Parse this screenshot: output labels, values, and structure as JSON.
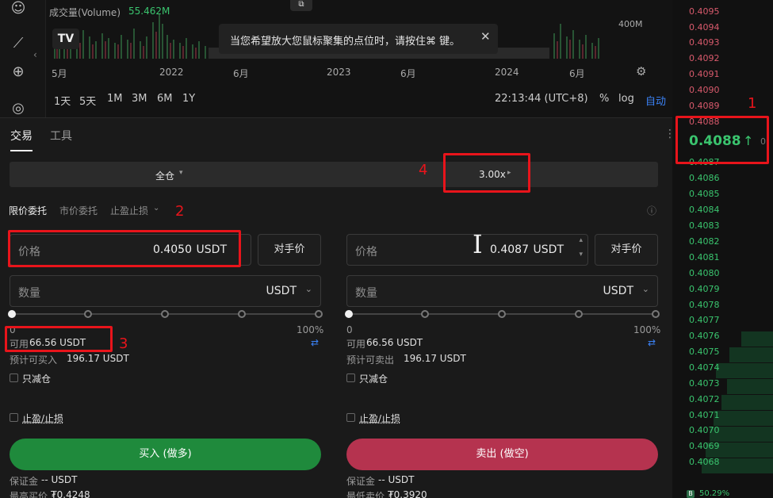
{
  "chart": {
    "volume_label": "成交量(Volume)",
    "volume_value": "55.462M",
    "axis_volume": "400M",
    "x_labels": [
      "5月",
      "2022",
      "6月",
      "2023",
      "6月",
      "2024",
      "6月"
    ],
    "tooltip": "当您希望放大您鼠标聚集的点位时，请按住⌘ 键。",
    "timeframes": [
      "1天",
      "5天",
      "1M",
      "3M",
      "6M",
      "1Y"
    ],
    "time": "22:13:44 (UTC+8)",
    "pct": "%",
    "log": "log",
    "auto": "自动"
  },
  "tabs": {
    "trade": "交易",
    "tools": "工具"
  },
  "margin": {
    "mode": "全仓",
    "leverage": "3.00x"
  },
  "order_types": {
    "limit": "限价委托",
    "market": "市价委托",
    "tpsl": "止盈止损"
  },
  "buy": {
    "price_label": "价格",
    "price_value": "0.4050",
    "price_unit": "USDT",
    "counter_price": "对手价",
    "qty_label": "数量",
    "qty_unit": "USDT",
    "pct_start": "0",
    "pct_end": "100%",
    "available_label": "可用",
    "available_value": "66.56 USDT",
    "estimate_label": "预计可买入",
    "estimate_value": "196.17 USDT",
    "reduce_only": "只减仓",
    "tp_sl": "止盈/止损",
    "button": "买入 (做多)",
    "margin_label": "保证金",
    "margin_value": "-- USDT",
    "limit_label": "最高买价",
    "limit_value": "₮0.4248"
  },
  "sell": {
    "price_label": "价格",
    "price_value": "0.4087",
    "price_unit": "USDT",
    "counter_price": "对手价",
    "qty_label": "数量",
    "qty_unit": "USDT",
    "pct_start": "0",
    "pct_end": "100%",
    "available_label": "可用",
    "available_value": "66.56 USDT",
    "estimate_label": "预计可卖出",
    "estimate_value": "196.17 USDT",
    "reduce_only": "只减仓",
    "tp_sl": "止盈/止损",
    "button": "卖出 (做空)",
    "margin_label": "保证金",
    "margin_value": "-- USDT",
    "limit_label": "最低卖价",
    "limit_value": "₮0.3920"
  },
  "orderbook": {
    "asks": [
      "0.4095",
      "0.4094",
      "0.4093",
      "0.4092",
      "0.4091",
      "0.4090",
      "0.4089",
      "0.4088"
    ],
    "last_price": "0.4088",
    "last_arrow": "↑",
    "bids": [
      "0.4087",
      "0.4086",
      "0.4085",
      "0.4084",
      "0.4083",
      "0.4082",
      "0.4081",
      "0.4080",
      "0.4079",
      "0.4078",
      "0.4077",
      "0.4076",
      "0.4075",
      "0.4074",
      "0.4073",
      "0.4072",
      "0.4071",
      "0.4070",
      "0.4069",
      "0.4068"
    ],
    "bottom_ratio": "50.29%",
    "colors": {
      "ask": "#d85a6c",
      "bid": "#3ac46e"
    }
  },
  "annotations": [
    "1",
    "2",
    "3",
    "4"
  ]
}
